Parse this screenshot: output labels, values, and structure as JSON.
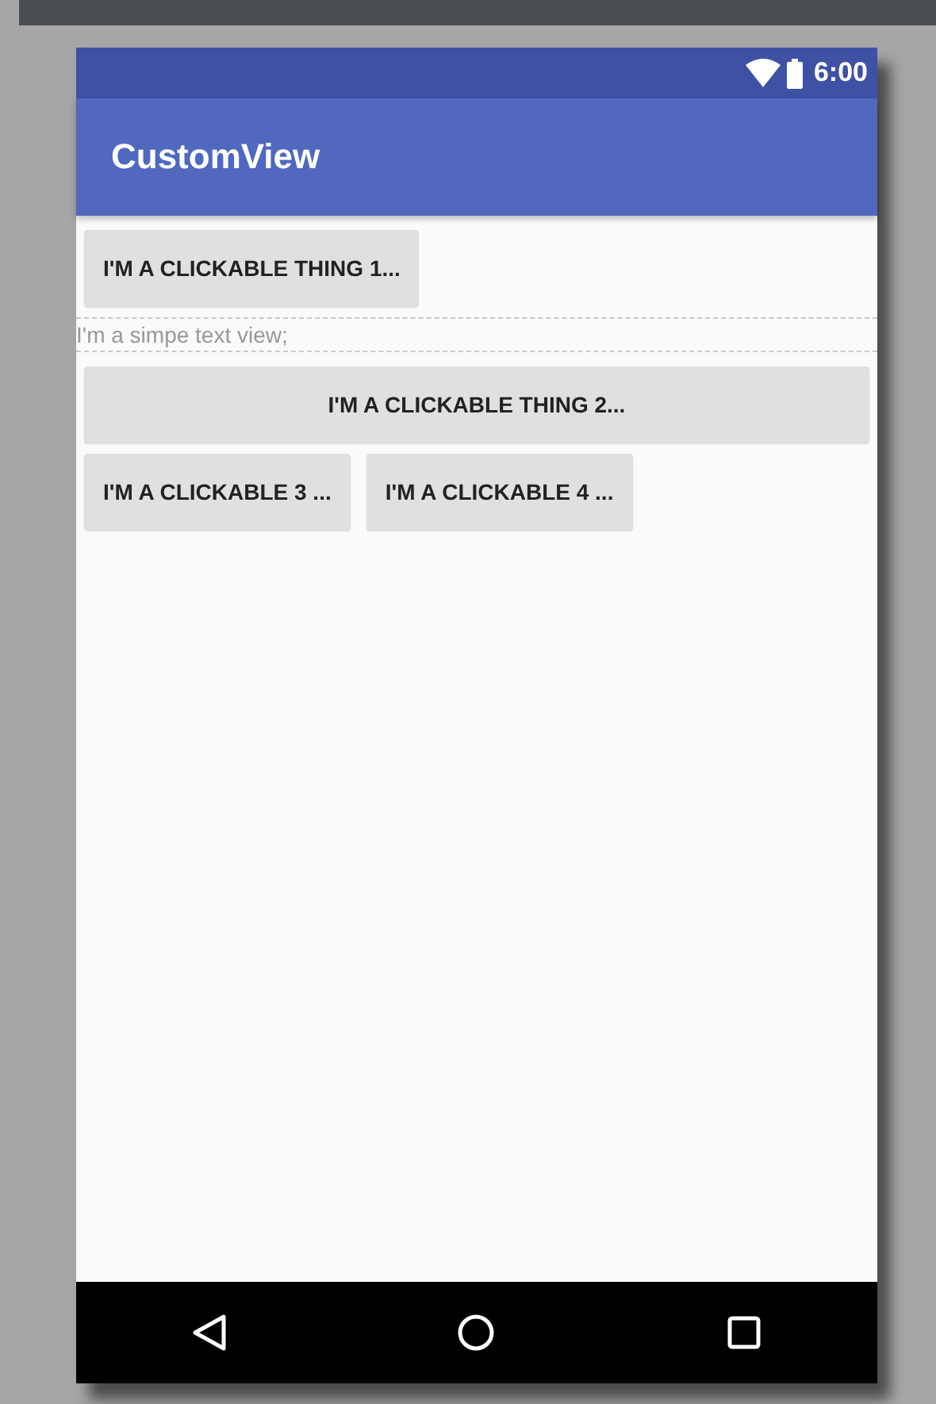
{
  "status_bar": {
    "time": "6:00"
  },
  "app_bar": {
    "title": "CustomView"
  },
  "rows": [
    {
      "items": [
        {
          "kind": "button",
          "label": "I'M A CLICKABLE THING 1...",
          "stretch": false
        }
      ]
    },
    {
      "items": [
        {
          "kind": "text",
          "label": "I'm a simpe text view;",
          "stretch": true
        }
      ]
    },
    {
      "items": [
        {
          "kind": "button",
          "label": "I'M A CLICKABLE THING 2...",
          "stretch": true
        }
      ]
    },
    {
      "items": [
        {
          "kind": "button",
          "label": "I'M A CLICKABLE 3 ...",
          "stretch": false
        },
        {
          "kind": "button",
          "label": "I'M A CLICKABLE 4 ...",
          "stretch": false
        }
      ]
    }
  ]
}
